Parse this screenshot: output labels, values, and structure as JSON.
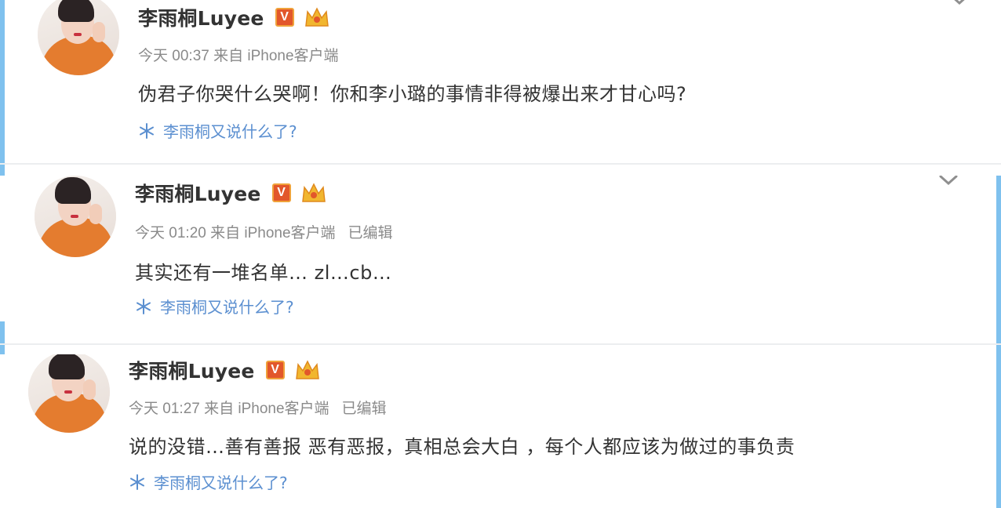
{
  "posts": [
    {
      "user_name": "李雨桐Luyee",
      "v_badge": "V",
      "meta": "今天 00:37 来自 iPhone客户端",
      "edited": "",
      "content": "伪君子你哭什么哭啊！你和李小璐的事情非得被爆出来才甘心吗?",
      "topic": "李雨桐又说什么了?"
    },
    {
      "user_name": "李雨桐Luyee",
      "v_badge": "V",
      "meta": "今天 01:20 来自 iPhone客户端",
      "edited": "已编辑",
      "content": "其实还有一堆名单… zl…cb…",
      "topic": "李雨桐又说什么了?"
    },
    {
      "user_name": "李雨桐Luyee",
      "v_badge": "V",
      "meta": "今天 01:27 来自 iPhone客户端",
      "edited": "已编辑",
      "content": "说的没错…善有善报 恶有恶报，真相总会大白 ，每个人都应该为做过的事负责",
      "topic": "李雨桐又说什么了?"
    }
  ],
  "colors": {
    "accent_blue": "#5b8fd0",
    "v_badge": "#e2572b",
    "avatar_coat": "#e47c2f",
    "frame_blue": "#7fc1ee"
  }
}
